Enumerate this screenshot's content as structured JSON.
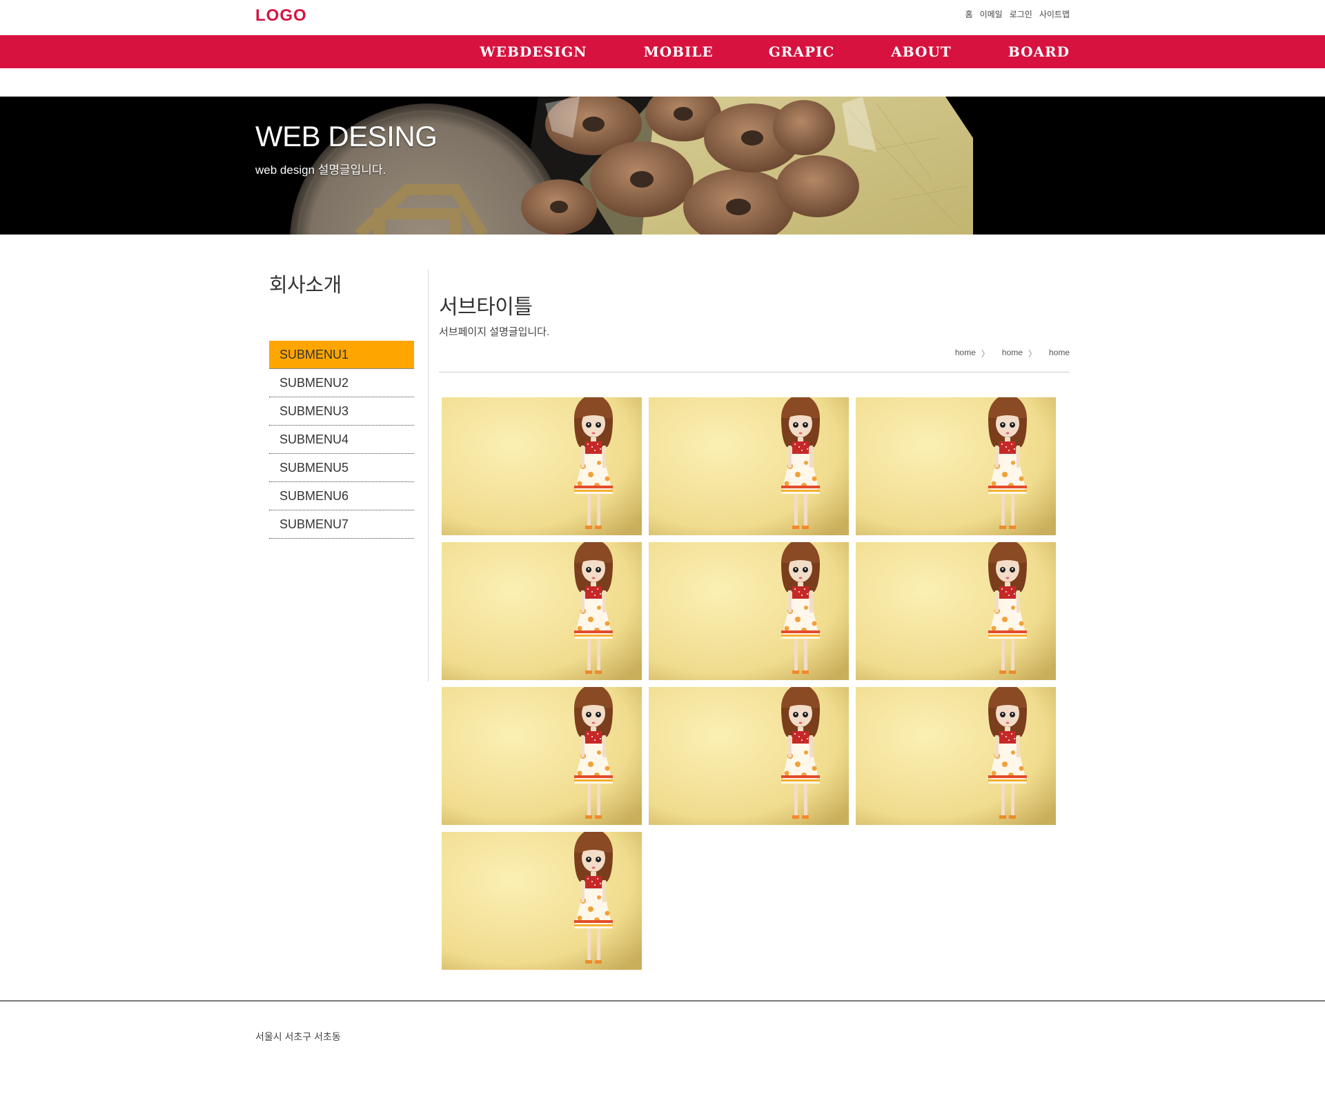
{
  "header": {
    "logo": "LOGO",
    "util_links": [
      "홈",
      "이메일",
      "로그인",
      "사이트맵"
    ]
  },
  "gnb": {
    "items": [
      "WEBDESIGN",
      "MOBILE",
      "GRAPIC",
      "ABOUT",
      "BOARD"
    ]
  },
  "visual": {
    "title": "WEB DESING",
    "desc": "web design 설명글입니다."
  },
  "lnb": {
    "title": "회사소개",
    "items": [
      "SUBMENU1",
      "SUBMENU2",
      "SUBMENU3",
      "SUBMENU4",
      "SUBMENU5",
      "SUBMENU6",
      "SUBMENU7"
    ],
    "active_index": 0
  },
  "content": {
    "title": "서브타이틀",
    "desc": "서브페이지 설명글입니다.",
    "breadcrumb": [
      "home",
      "home",
      "home"
    ]
  },
  "gallery": {
    "count": 10,
    "icon": "doll-photo"
  },
  "footer": {
    "address": "서울시 서초구 서초동"
  },
  "colors": {
    "brand": "#d7123f",
    "active_menu": "#ffa500",
    "visual_bg": "#000000"
  }
}
